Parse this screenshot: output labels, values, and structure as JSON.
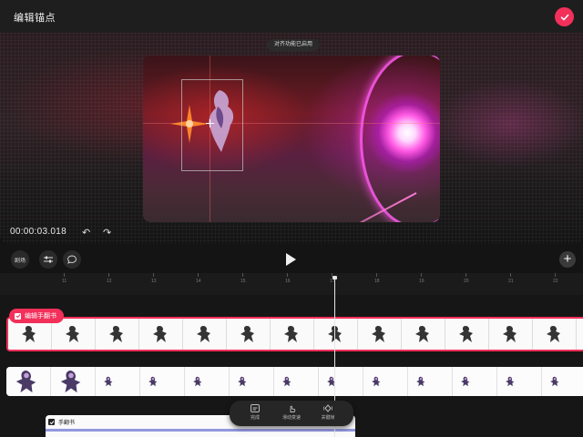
{
  "header": {
    "title": "编辑锚点"
  },
  "preview": {
    "toast": "对齐功能已启用",
    "timecode": "00:00:03.018"
  },
  "toolbar": {
    "scene_label": "剧场"
  },
  "ruler": {
    "ticks": [
      "11",
      "12",
      "13",
      "14",
      "15",
      "16",
      "17",
      "18",
      "19",
      "20",
      "21",
      "22",
      "23"
    ]
  },
  "tracks": {
    "track1_label": "编辑手翻书",
    "track3_label": "手翻书"
  },
  "floating_bar": {
    "items": [
      {
        "label": "完成",
        "icon": "subtitle-icon"
      },
      {
        "label": "滑动变速",
        "icon": "touch-icon"
      },
      {
        "label": "关键帧",
        "icon": "keyframe-icon"
      }
    ]
  },
  "colors": {
    "accent": "#f2305a",
    "background": "#141414"
  }
}
